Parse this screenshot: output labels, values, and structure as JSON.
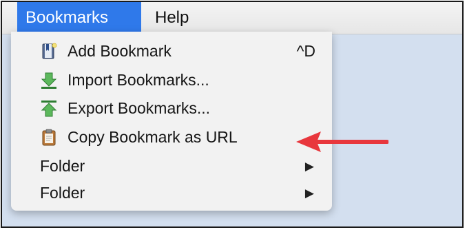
{
  "menubar": {
    "menus": [
      {
        "label": "Bookmarks"
      },
      {
        "label": "Help"
      }
    ]
  },
  "dropdown": {
    "items": [
      {
        "label": "Add Bookmark",
        "shortcut": "^D",
        "icon": "bookmark-book-icon"
      },
      {
        "label": "Import Bookmarks...",
        "icon": "import-down-arrow-icon"
      },
      {
        "label": "Export Bookmarks...",
        "icon": "export-up-arrow-icon"
      },
      {
        "label": "Copy Bookmark as URL",
        "icon": "clipboard-icon"
      },
      {
        "label": "Folder",
        "submenu": true
      },
      {
        "label": "Folder",
        "submenu": true
      }
    ]
  },
  "annotation": {
    "icon": "red-arrow-icon",
    "color": "#e8373d"
  },
  "colors": {
    "accent": "#2f79ea",
    "menubar": "#ececec",
    "background": "#d3dfef",
    "menu": "#f2f2f2"
  }
}
